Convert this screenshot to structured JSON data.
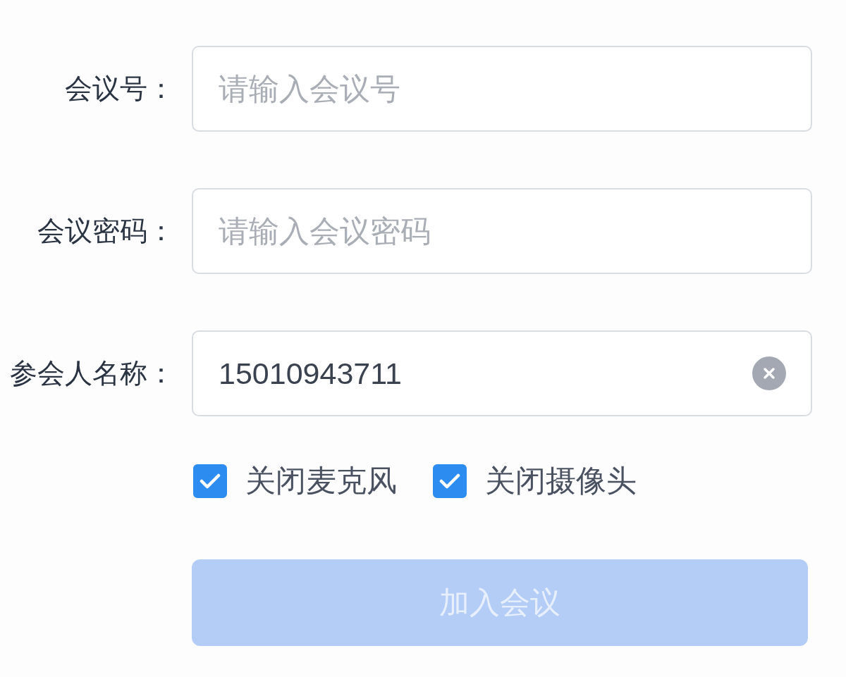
{
  "fields": [
    {
      "label": "会议号：",
      "placeholder": "请输入会议号"
    },
    {
      "label": "会议密码：",
      "placeholder": "请输入会议密码"
    },
    {
      "label": "参会人名称：",
      "value": "15010943711",
      "clearable": true
    }
  ],
  "options": [
    {
      "label": "关闭麦克风",
      "checked": true
    },
    {
      "label": "关闭摄像头",
      "checked": true
    }
  ],
  "join_button": {
    "label": "加入会议",
    "disabled": true
  }
}
